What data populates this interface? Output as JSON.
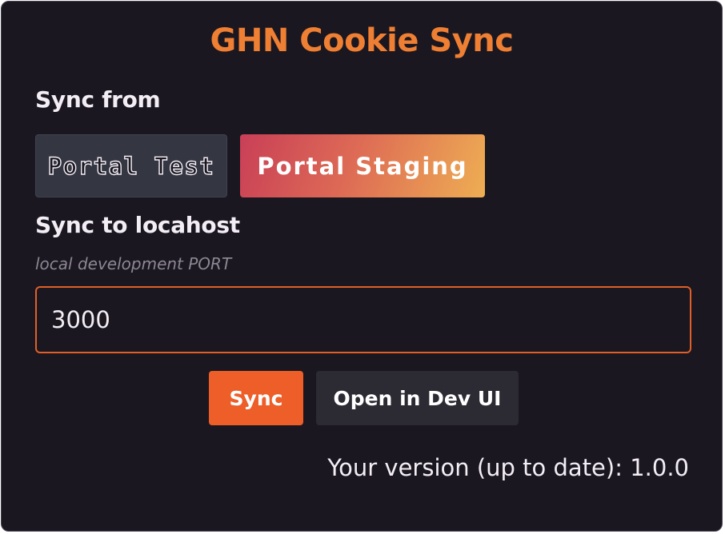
{
  "app": {
    "title": "GHN Cookie Sync"
  },
  "sync_from": {
    "label": "Sync from",
    "options": [
      {
        "label": "Portal Test",
        "selected": false
      },
      {
        "label": "Portal Staging",
        "selected": true
      }
    ]
  },
  "sync_to": {
    "label": "Sync to locahost",
    "hint": "local development PORT",
    "port_value": "3000"
  },
  "actions": {
    "sync_label": "Sync",
    "open_dev_label": "Open in Dev UI"
  },
  "footer": {
    "version_text": "Your version (up to date): 1.0.0"
  },
  "colors": {
    "accent": "#ee7f33",
    "sync_button": "#ed5e28",
    "background": "#1b1720"
  }
}
